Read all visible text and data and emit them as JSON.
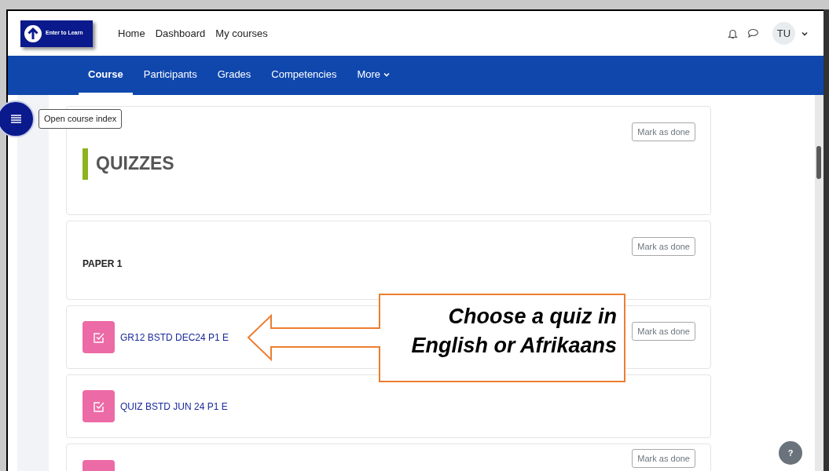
{
  "header": {
    "logo_text": "Enter to Learn",
    "nav_links": [
      "Home",
      "Dashboard",
      "My courses"
    ],
    "avatar": "TU"
  },
  "tabs": [
    {
      "label": "Course",
      "selected": true
    },
    {
      "label": "Participants",
      "selected": false
    },
    {
      "label": "Grades",
      "selected": false
    },
    {
      "label": "Competencies",
      "selected": false
    },
    {
      "label": "More",
      "selected": false
    }
  ],
  "course_index_tooltip": "Open course index",
  "sections": [
    {
      "kind": "heading",
      "title": "QUIZZES",
      "mark_button": "Mark as done"
    },
    {
      "kind": "subheading",
      "title": "PAPER 1",
      "mark_button": "Mark as done"
    },
    {
      "kind": "quiz",
      "title": "GR12 BSTD DEC24 P1 E",
      "mark_button": "Mark as done"
    },
    {
      "kind": "quiz",
      "title": "QUIZ BSTD JUN 24 P1 E"
    },
    {
      "kind": "quiz",
      "mark_button": "Mark as done"
    }
  ],
  "callout": {
    "text": "Choose a quiz in\nEnglish or Afrikaans"
  },
  "help_button": "?"
}
